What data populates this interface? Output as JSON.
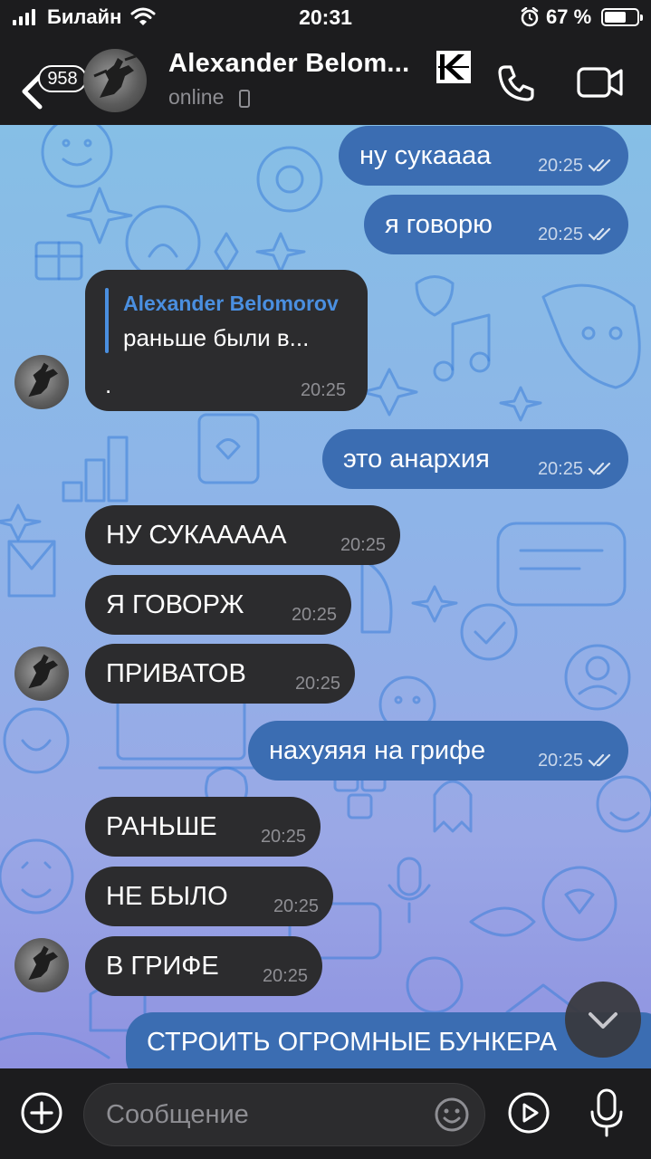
{
  "status_bar": {
    "carrier": "Билайн",
    "time": "20:31",
    "battery_percent": "67 %",
    "battery_level": 0.67
  },
  "header": {
    "unread_count": "958",
    "contact_name": "Alexander Belom...",
    "contact_status": "online"
  },
  "messages": [
    {
      "dir": "out",
      "text": "ну сукаааа",
      "time": "20:25",
      "read": true
    },
    {
      "dir": "out",
      "text": "я говорю",
      "time": "20:25",
      "read": true
    },
    {
      "dir": "in",
      "type": "reply",
      "reply_author": "Alexander Belomorov",
      "reply_text": "раньше были в...",
      "text": ".",
      "time": "20:25"
    },
    {
      "dir": "out",
      "text": "это анархия",
      "time": "20:25",
      "read": true
    },
    {
      "dir": "in",
      "text": "НУ СУКААААА",
      "time": "20:25"
    },
    {
      "dir": "in",
      "text": "Я ГОВОРЖ",
      "time": "20:25"
    },
    {
      "dir": "in",
      "text": "ПРИВАТОВ",
      "time": "20:25"
    },
    {
      "dir": "out",
      "text": "нахуяяя на грифе",
      "time": "20:25",
      "read": true
    },
    {
      "dir": "in",
      "text": "РАНЬШЕ",
      "time": "20:25"
    },
    {
      "dir": "in",
      "text": "НЕ БЫЛО",
      "time": "20:25"
    },
    {
      "dir": "in",
      "text": "В ГРИФЕ",
      "time": "20:25"
    },
    {
      "dir": "out",
      "text": "СТРОИТЬ ОГРОМНЫЕ БУНКЕРА",
      "time": "",
      "partial": true
    }
  ],
  "input": {
    "placeholder": "Сообщение"
  },
  "icons": [
    "back-chevron-icon",
    "call-icon",
    "video-call-icon",
    "attach-icon",
    "emoji-icon",
    "video-message-icon",
    "microphone-icon",
    "chevron-down-icon",
    "double-check-icon"
  ],
  "colors": {
    "outgoing_bubble": "#3b6db2",
    "incoming_bubble": "#2c2c2e",
    "accent": "#4a8fe0",
    "bar_background": "#1c1c1e"
  }
}
